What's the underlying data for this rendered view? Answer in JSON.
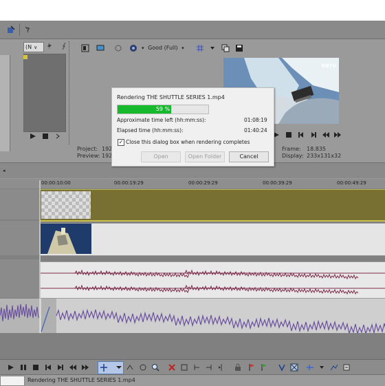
{
  "toolbar": {
    "new_label": "(N",
    "quality_label": "Good (Full)"
  },
  "preview": {
    "logo_text": "DBTV",
    "frame_label": "Frame:",
    "frame_value": "18.835",
    "display_label": "Display:",
    "display_value": "233x131x32",
    "project_label": "Project:",
    "project_value": "192",
    "preview_label": "Preview:",
    "preview_value": "192"
  },
  "dialog": {
    "title": "Rendering THE SHUTTLE SERIES 1.mp4",
    "progress_text": "59 %",
    "progress_fraction": 0.59,
    "approx_label": "Approximate time left (hh:mm:ss):",
    "approx_value": "01:08:19",
    "elapsed_label": "Elapsed time (hh:mm:ss):",
    "elapsed_value": "01:40:24",
    "checkbox_label": "Close this dialog box when rendering completes",
    "checkbox_checked": true,
    "open_label": "Open",
    "open_folder_label": "Open Folder",
    "cancel_label": "Cancel"
  },
  "ruler": {
    "ticks": [
      "00:00:10:00",
      "00:00:19:29",
      "00:00:29:29",
      "00:00:39:29",
      "00:00:49:29"
    ]
  },
  "status": {
    "text": "Rendering THE SHUTTLE SERIES 1.mp4"
  },
  "colors": {
    "progress": "#16b82c",
    "video_track": "#787033",
    "audio_wave": "#7b2a4a",
    "bottom_wave": "#6a4fa0"
  }
}
